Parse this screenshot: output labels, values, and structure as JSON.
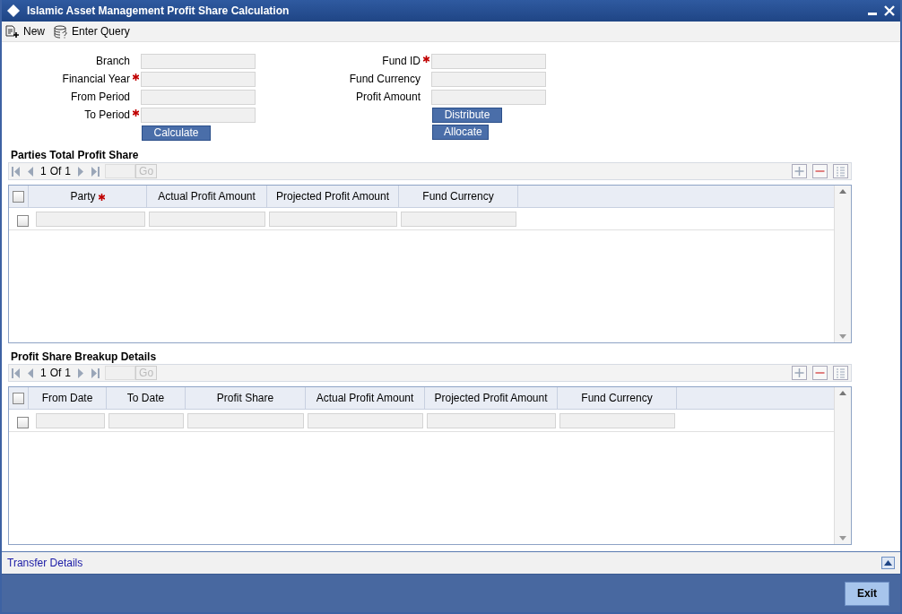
{
  "window": {
    "title": "Islamic Asset Management Profit Share Calculation"
  },
  "toolbar": [
    {
      "label": "New",
      "kind": "new"
    },
    {
      "label": "Enter Query",
      "kind": "query"
    }
  ],
  "form": {
    "left": [
      {
        "label": "Branch",
        "required": false
      },
      {
        "label": "Financial Year",
        "required": true
      },
      {
        "label": "From Period",
        "required": false
      },
      {
        "label": "To Period",
        "required": true
      }
    ],
    "calculate": "Calculate",
    "right": [
      {
        "label": "Fund ID",
        "required": true
      },
      {
        "label": "Fund Currency",
        "required": false
      },
      {
        "label": "Profit Amount",
        "required": false
      }
    ],
    "buttons": [
      "Distribute",
      "Allocate"
    ]
  },
  "grids": [
    {
      "title": "Parties Total Profit Share",
      "pager": {
        "page": "1",
        "of": "Of",
        "total": "1",
        "go": "Go"
      },
      "header_checked": false,
      "columns": [
        {
          "label": "Party",
          "required": true
        },
        {
          "label": "Actual Profit Amount",
          "required": false
        },
        {
          "label": "Projected Profit Amount",
          "required": false
        },
        {
          "label": "Fund Currency",
          "required": false
        }
      ],
      "rows": [
        {
          "checked": false
        }
      ]
    },
    {
      "title": "Profit Share Breakup Details",
      "pager": {
        "page": "1",
        "of": "Of",
        "total": "1",
        "go": "Go"
      },
      "header_checked": false,
      "columns": [
        {
          "label": "From Date",
          "required": false
        },
        {
          "label": "To Date",
          "required": false
        },
        {
          "label": "Profit Share",
          "required": false
        },
        {
          "label": "Actual Profit Amount",
          "required": false
        },
        {
          "label": "Projected Profit Amount",
          "required": false
        },
        {
          "label": "Fund Currency",
          "required": false
        }
      ],
      "rows": [
        {
          "checked": false
        }
      ]
    }
  ],
  "footer": {
    "link": "Transfer Details",
    "exit": "Exit"
  }
}
